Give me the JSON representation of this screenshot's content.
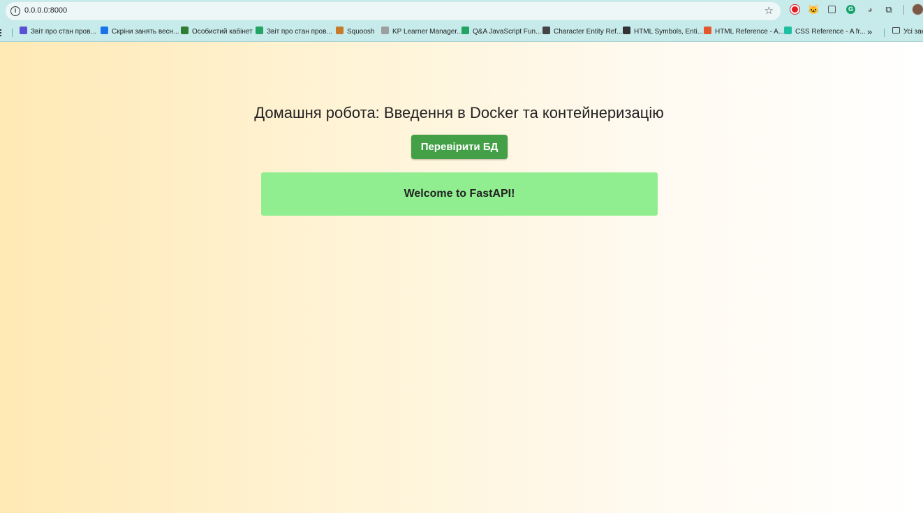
{
  "browser": {
    "url": "0.0.0.0:8000",
    "bookmarks": [
      {
        "label": "Звіт про стан пров...",
        "color": "#5b4fd6"
      },
      {
        "label": "Скріни занять весн...",
        "color": "#1a73e8"
      },
      {
        "label": "Особистий кабінет",
        "color": "#2e7d32"
      },
      {
        "label": "Звіт про стан пров...",
        "color": "#21a464"
      },
      {
        "label": "Squoosh",
        "color": "#c77b2a"
      },
      {
        "label": "KP Learner Manager...",
        "color": "#9e9e9e"
      },
      {
        "label": "Q&A JavaScript Fun...",
        "color": "#21a464"
      },
      {
        "label": "Character Entity Ref...",
        "color": "#444444"
      },
      {
        "label": "HTML Symbols, Enti...",
        "color": "#333333"
      },
      {
        "label": "HTML Reference - A...",
        "color": "#e4572e"
      },
      {
        "label": "CSS Reference - A fr...",
        "color": "#1fbfa3"
      }
    ],
    "more_label": "»",
    "all_bookmarks_label": "Усі зак"
  },
  "page": {
    "heading": "Домашня робота: Введення в Docker та контейнеризацію",
    "check_button_label": "Перевірити БД",
    "result_message": "Welcome to FastAPI!",
    "button_color": "#43a047",
    "result_color": "#90ee90"
  }
}
